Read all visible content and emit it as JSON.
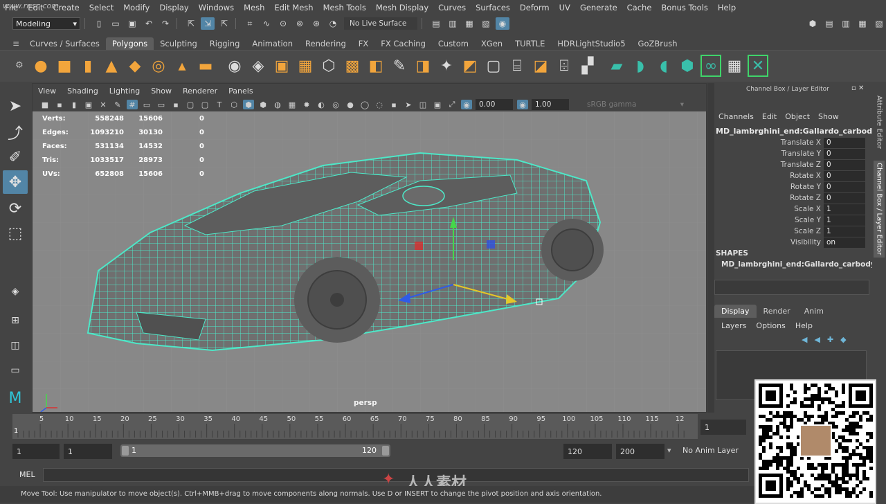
{
  "watermark_site": "www.rr-sc.com",
  "watermark_brand": "人人素材",
  "menubar": [
    "File",
    "Edit",
    "Create",
    "Select",
    "Modify",
    "Display",
    "Windows",
    "Mesh",
    "Edit Mesh",
    "Mesh Tools",
    "Mesh Display",
    "Curves",
    "Surfaces",
    "Deform",
    "UV",
    "Generate",
    "Cache",
    "Bonus Tools",
    "Help"
  ],
  "statusline": {
    "mode": "Modeling",
    "live_surface": "No Live Surface"
  },
  "shelf_tabs": [
    "Curves / Surfaces",
    "Polygons",
    "Sculpting",
    "Rigging",
    "Animation",
    "Rendering",
    "FX",
    "FX Caching",
    "Custom",
    "XGen",
    "TURTLE",
    "HDRLightStudio5",
    "GoZBrush"
  ],
  "active_shelf_tab": "Polygons",
  "viewport": {
    "menu": [
      "View",
      "Shading",
      "Lighting",
      "Show",
      "Renderer",
      "Panels"
    ],
    "exposure": "0.00",
    "gamma_value": "1.00",
    "color_space": "sRGB gamma",
    "camera": "persp",
    "hud": [
      {
        "label": "Verts:",
        "v1": "558248",
        "v2": "15606",
        "v3": "0"
      },
      {
        "label": "Edges:",
        "v1": "1093210",
        "v2": "30130",
        "v3": "0"
      },
      {
        "label": "Faces:",
        "v1": "531134",
        "v2": "14532",
        "v3": "0"
      },
      {
        "label": "Tris:",
        "v1": "1033517",
        "v2": "28973",
        "v3": "0"
      },
      {
        "label": "UVs:",
        "v1": "652808",
        "v2": "15606",
        "v3": "0"
      }
    ]
  },
  "channel_box": {
    "title": "Channel Box / Layer Editor",
    "menu": [
      "Channels",
      "Edit",
      "Object",
      "Show"
    ],
    "object": "MD_lambrghini_end:Gallardo_carbody",
    "attributes": [
      {
        "name": "Translate X",
        "value": "0"
      },
      {
        "name": "Translate Y",
        "value": "0"
      },
      {
        "name": "Translate Z",
        "value": "0"
      },
      {
        "name": "Rotate X",
        "value": "0"
      },
      {
        "name": "Rotate Y",
        "value": "0"
      },
      {
        "name": "Rotate Z",
        "value": "0"
      },
      {
        "name": "Scale X",
        "value": "1"
      },
      {
        "name": "Scale Y",
        "value": "1"
      },
      {
        "name": "Scale Z",
        "value": "1"
      },
      {
        "name": "Visibility",
        "value": "on"
      }
    ],
    "shapes_header": "SHAPES",
    "shape_name": "MD_lambrghini_end:Gallardo_carbody..."
  },
  "layer_editor": {
    "tabs": [
      "Display",
      "Render",
      "Anim"
    ],
    "menu": [
      "Layers",
      "Options",
      "Help"
    ]
  },
  "side_tabs": [
    "Attribute Editor",
    "Channel Box / Layer Editor"
  ],
  "timeline": {
    "ticks": [
      "5",
      "10",
      "15",
      "20",
      "25",
      "30",
      "35",
      "40",
      "45",
      "50",
      "55",
      "60",
      "65",
      "70",
      "75",
      "80",
      "85",
      "90",
      "95",
      "100",
      "105",
      "110",
      "115",
      "12"
    ],
    "current_frame_label": "1",
    "current_frame": "1"
  },
  "range": {
    "start": "1",
    "playback_start": "1",
    "slider_start": "1",
    "slider_end": "120",
    "playback_end": "120",
    "end": "200",
    "anim_layer": "No Anim Layer"
  },
  "cmdline": {
    "label": "MEL"
  },
  "help_line": "Move Tool: Use manipulator to move object(s). Ctrl+MMB+drag to move components along normals. Use D or INSERT to change the pivot position and axis orientation.",
  "colors": {
    "accent": "#5285a6",
    "wireframe": "#4de8c8",
    "shelf_orange": "#f2a53c"
  }
}
